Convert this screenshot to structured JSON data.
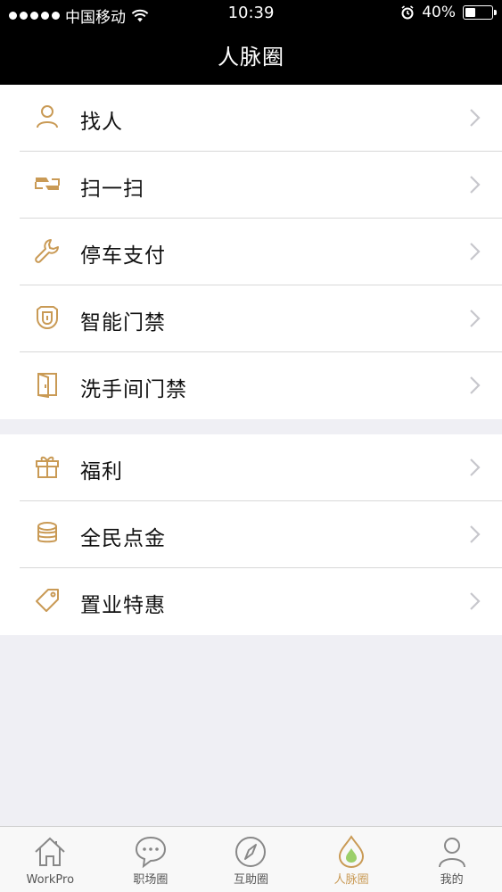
{
  "status_bar": {
    "carrier": "中国移动",
    "time": "10:39",
    "battery": "40%",
    "battery_level": 0.4
  },
  "nav": {
    "title": "人脉圈"
  },
  "groups": [
    {
      "items": [
        {
          "label": "找人",
          "icon": "person-icon"
        },
        {
          "label": "扫一扫",
          "icon": "scan-icon"
        },
        {
          "label": "停车支付",
          "icon": "wrench-icon"
        },
        {
          "label": "智能门禁",
          "icon": "door-access-icon"
        },
        {
          "label": "洗手间门禁",
          "icon": "door-icon"
        }
      ]
    },
    {
      "items": [
        {
          "label": "福利",
          "icon": "gift-icon"
        },
        {
          "label": "全民点金",
          "icon": "coins-icon"
        },
        {
          "label": "置业特惠",
          "icon": "tag-icon"
        }
      ]
    }
  ],
  "tabs": [
    {
      "label": "WorkPro",
      "icon": "home-icon",
      "active": false
    },
    {
      "label": "职场圈",
      "icon": "chat-icon",
      "active": false
    },
    {
      "label": "互助圈",
      "icon": "compass-icon",
      "active": false
    },
    {
      "label": "人脉圈",
      "icon": "drop-icon",
      "active": true
    },
    {
      "label": "我的",
      "icon": "profile-icon",
      "active": false
    }
  ],
  "colors": {
    "accent": "#c99a55",
    "nav_background": "#000000",
    "page_background": "#efeff4",
    "tab_inactive": "#888888"
  }
}
